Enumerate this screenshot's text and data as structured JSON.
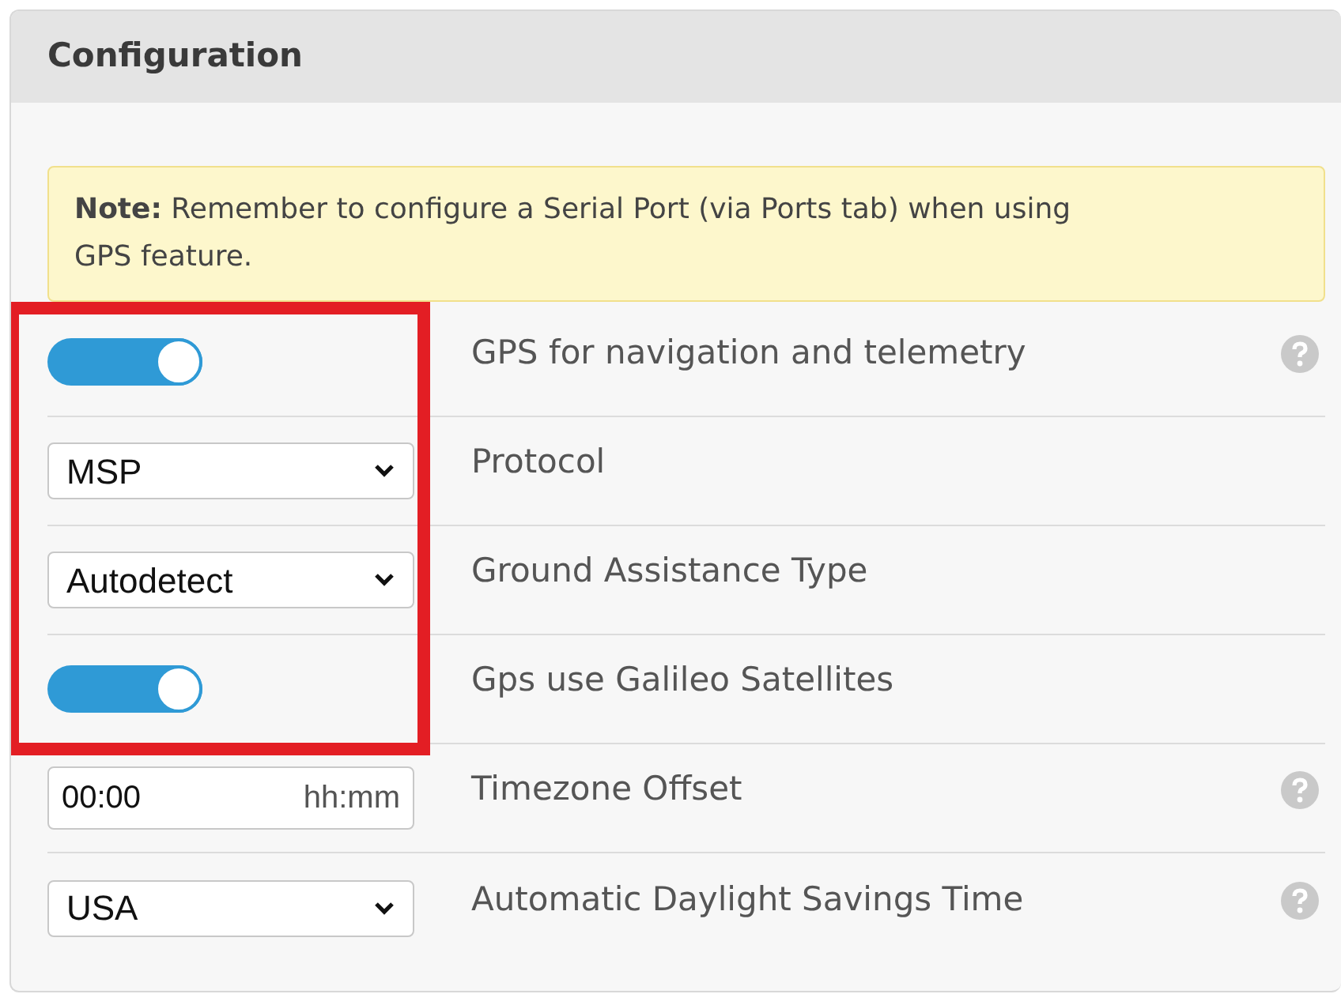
{
  "panel": {
    "title": "Configuration"
  },
  "note": {
    "text": "**Note:** Remember to configure a Serial Port (via Ports tab) when using GPS feature."
  },
  "rows": [
    {
      "kind": "toggle",
      "on": true,
      "label": "GPS for navigation and telemetry",
      "help": true,
      "highlighted": true
    },
    {
      "kind": "select",
      "value": "MSP",
      "label": "Protocol",
      "help": false,
      "highlighted": true
    },
    {
      "kind": "select",
      "value": "Autodetect",
      "label": "Ground Assistance Type",
      "help": false,
      "highlighted": true
    },
    {
      "kind": "toggle",
      "on": true,
      "label": "Gps use Galileo Satellites",
      "help": false,
      "highlighted": true
    },
    {
      "kind": "time",
      "value": "00:00",
      "unit": "hh:mm",
      "label": "Timezone Offset",
      "help": true,
      "highlighted": false
    },
    {
      "kind": "select",
      "value": "USA",
      "label": "Automatic Daylight Savings Time",
      "help": true,
      "highlighted": false
    }
  ]
}
